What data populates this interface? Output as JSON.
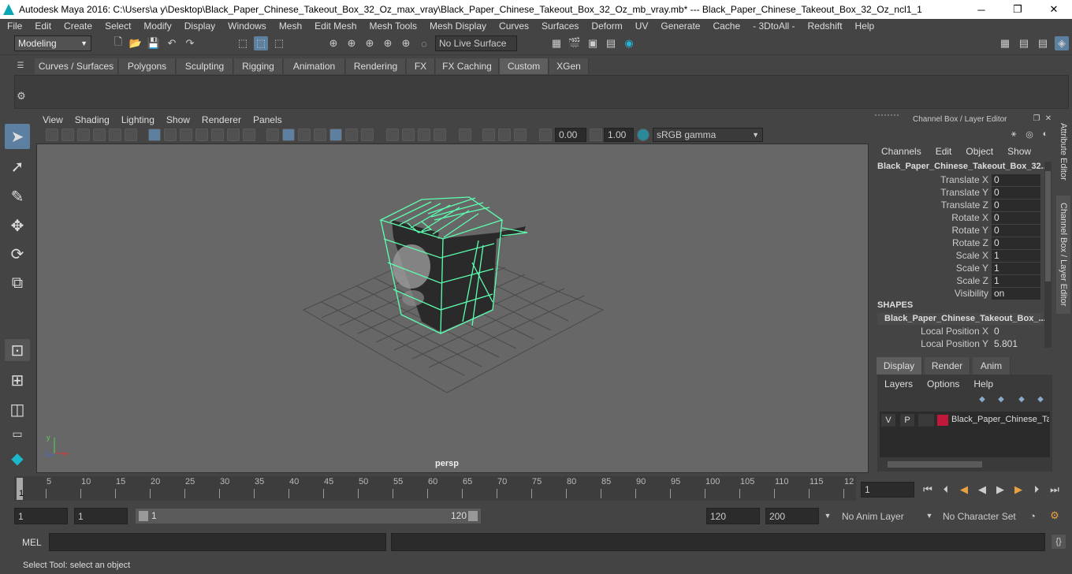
{
  "app": {
    "title": "Autodesk Maya 2016: C:\\Users\\a y\\Desktop\\Black_Paper_Chinese_Takeout_Box_32_Oz_max_vray\\Black_Paper_Chinese_Takeout_Box_32_Oz_mb_vray.mb*   ---   Black_Paper_Chinese_Takeout_Box_32_Oz_ncl1_1",
    "window_controls": [
      "─",
      "❐",
      "✕"
    ]
  },
  "menus": [
    "File",
    "Edit",
    "Create",
    "Select",
    "Modify",
    "Display",
    "Windows",
    "Mesh",
    "Edit Mesh",
    "Mesh Tools",
    "Mesh Display",
    "Curves",
    "Surfaces",
    "Deform",
    "UV",
    "Generate",
    "Cache",
    "- 3DtoAll -",
    "Redshift",
    "Help"
  ],
  "status": {
    "mode": "Modeling",
    "live_surface": "No Live Surface"
  },
  "shelf": {
    "tabs": [
      "Curves / Surfaces",
      "Polygons",
      "Sculpting",
      "Rigging",
      "Animation",
      "Rendering",
      "FX",
      "FX Caching",
      "Custom",
      "XGen"
    ],
    "active_tab": "Custom"
  },
  "viewport": {
    "menus": [
      "View",
      "Shading",
      "Lighting",
      "Show",
      "Renderer",
      "Panels"
    ],
    "exposure": "0.00",
    "gamma": "1.00",
    "color_space": "sRGB gamma",
    "camera_label": "persp",
    "wire_color": "#5dffb0"
  },
  "channel_box": {
    "header": "Channel Box / Layer Editor",
    "menus": [
      "Channels",
      "Edit",
      "Object",
      "Show"
    ],
    "object_name": "Black_Paper_Chinese_Takeout_Box_32...",
    "attributes": [
      {
        "label": "Translate X",
        "value": "0"
      },
      {
        "label": "Translate Y",
        "value": "0"
      },
      {
        "label": "Translate Z",
        "value": "0"
      },
      {
        "label": "Rotate X",
        "value": "0"
      },
      {
        "label": "Rotate Y",
        "value": "0"
      },
      {
        "label": "Rotate Z",
        "value": "0"
      },
      {
        "label": "Scale X",
        "value": "1"
      },
      {
        "label": "Scale Y",
        "value": "1"
      },
      {
        "label": "Scale Z",
        "value": "1"
      },
      {
        "label": "Visibility",
        "value": "on"
      }
    ],
    "shapes_header": "SHAPES",
    "shape_name": "Black_Paper_Chinese_Takeout_Box_...",
    "shape_attributes": [
      {
        "label": "Local Position X",
        "value": "0"
      },
      {
        "label": "Local Position Y",
        "value": "5.801"
      }
    ]
  },
  "layer_editor": {
    "tabs": [
      "Display",
      "Render",
      "Anim"
    ],
    "active_tab": "Display",
    "menus": [
      "Layers",
      "Options",
      "Help"
    ],
    "layer": {
      "v": "V",
      "p": "P",
      "name": "Black_Paper_Chinese_Tak",
      "color": "#c0183a"
    }
  },
  "side_tabs": [
    "Attribute Editor",
    "Channel Box / Layer Editor"
  ],
  "timeline": {
    "labels": [
      "5",
      "10",
      "15",
      "20",
      "25",
      "30",
      "35",
      "40",
      "45",
      "50",
      "55",
      "60",
      "65",
      "70",
      "75",
      "80",
      "85",
      "90",
      "95",
      "100",
      "105",
      "110",
      "115",
      "12"
    ],
    "start_marker": "1",
    "current_frame": "1"
  },
  "range": {
    "start": "1",
    "start2": "1",
    "slider_start": "1",
    "slider_end": "120",
    "end": "120",
    "end2": "200",
    "anim_layer": "No Anim Layer",
    "char_set": "No Character Set"
  },
  "mel": {
    "label": "MEL"
  },
  "help_line": "Select Tool: select an object"
}
